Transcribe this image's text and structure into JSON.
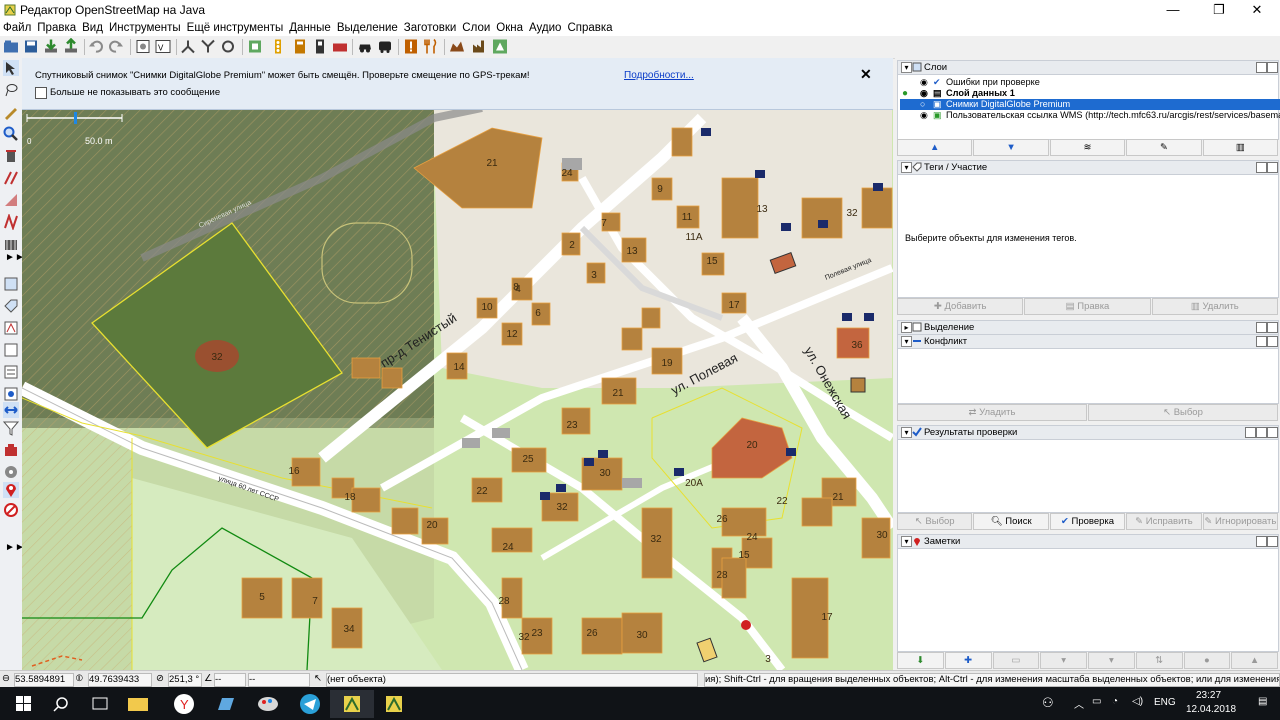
{
  "window": {
    "title": "Редактор OpenStreetMap на Java",
    "controls": [
      "—",
      "❐",
      "✕"
    ]
  },
  "menu": [
    "Файл",
    "Правка",
    "Вид",
    "Инструменты",
    "Ещё инструменты",
    "Данные",
    "Выделение",
    "Заготовки",
    "Слои",
    "Окна",
    "Аудио",
    "Справка"
  ],
  "notice": {
    "message": "Спутниковый снимок \"Снимки DigitalGlobe Premium\" может быть смещён. Проверьте смещение по GPS-трекам!",
    "more_link": "Подробности...",
    "close": "✕",
    "dont_show": "Больше не показывать это сообщение"
  },
  "map": {
    "scale": "50.0 m",
    "scale_zero": "0",
    "streets": [
      "пр-д Тенистый",
      "ул. Полевая",
      "ул. Онежская",
      "Сиреневая улица",
      "Полевая улица",
      "улица 60 лет СССР"
    ],
    "house_numbers": [
      "21",
      "24",
      "9",
      "11",
      "11А",
      "15",
      "7",
      "2",
      "13",
      "3",
      "4",
      "8",
      "10",
      "12",
      "6",
      "17",
      "14",
      "19",
      "21",
      "23",
      "25",
      "20",
      "26",
      "30",
      "20А",
      "22",
      "24",
      "32",
      "18",
      "16",
      "20",
      "22",
      "24",
      "28",
      "23",
      "32",
      "30",
      "26",
      "28",
      "32",
      "15",
      "17",
      "3",
      "5",
      "7",
      "34",
      "36",
      "13",
      "21",
      "30",
      "32"
    ]
  },
  "panels": {
    "layers": {
      "title": "Слои",
      "items": [
        {
          "name": "Ошибки при проверке",
          "bold": false,
          "selected": false
        },
        {
          "name": "Слой данных 1",
          "bold": true,
          "selected": false
        },
        {
          "name": "Снимки DigitalGlobe Premium",
          "bold": false,
          "selected": true
        },
        {
          "name": "Пользовательская ссылка WMS (http://tech.mfc63.ru/arcgis/rest/services/basemap...",
          "bold": false,
          "selected": false
        }
      ]
    },
    "tags": {
      "title": "Теги / Участие",
      "empty": "Выберите объекты для изменения тегов.",
      "buttons": [
        "Добавить",
        "Правка",
        "Удалить"
      ]
    },
    "selection": {
      "title": "Выделение"
    },
    "conflict": {
      "title": "Конфликт",
      "buttons": [
        "Уладить",
        "Выбор"
      ]
    },
    "validation": {
      "title": "Результаты проверки",
      "buttons": [
        "Выбор",
        "Поиск",
        "Проверка",
        "Исправить",
        "Игнорировать"
      ]
    },
    "notes": {
      "title": "Заметки"
    }
  },
  "status": {
    "lat": "53.5894891",
    "lon": "49.7639433",
    "angle": "251,3 °",
    "dist1": "--",
    "dist2": "--",
    "object": "(нет объекта)",
    "hint": "ия); Shift-Ctrl - для вращения выделенных объектов; Alt-Ctrl - для изменения масштаба выделенных объектов; или для изменения выделения"
  },
  "taskbar": {
    "lang": "ENG",
    "time": "23:27",
    "date": "12.04.2018"
  },
  "colors": {
    "map_bg": "#cfe7b0",
    "building": "#b5823e",
    "building_selected": "#c3653f",
    "road": "#ffffff",
    "selection": "#1e5cc8",
    "taskbar": "#101317"
  }
}
